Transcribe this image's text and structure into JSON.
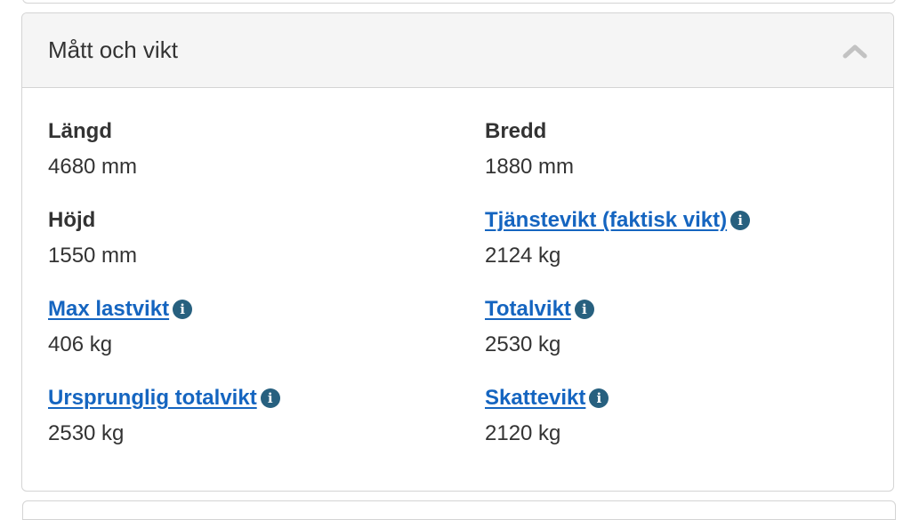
{
  "panel": {
    "title": "Mått och vikt",
    "collapse_icon": "chevron-up-icon"
  },
  "items": [
    {
      "label": "Längd",
      "value": "4680 mm",
      "link": false
    },
    {
      "label": "Bredd",
      "value": "1880 mm",
      "link": false
    },
    {
      "label": "Höjd",
      "value": "1550 mm",
      "link": false
    },
    {
      "label": "Tjänstevikt (faktisk vikt)",
      "value": "2124 kg",
      "link": true
    },
    {
      "label": "Max lastvikt",
      "value": "406 kg",
      "link": true
    },
    {
      "label": "Totalvikt",
      "value": "2530 kg",
      "link": true
    },
    {
      "label": "Ursprunglig totalvikt",
      "value": "2530 kg",
      "link": true
    },
    {
      "label": "Skattevikt",
      "value": "2120 kg",
      "link": true
    }
  ],
  "colors": {
    "link": "#1565c0",
    "info_icon": "#27607f",
    "header_bg": "#f5f5f5",
    "border": "#d4d4d4",
    "text": "#333333"
  },
  "info_icon_glyph": "i"
}
